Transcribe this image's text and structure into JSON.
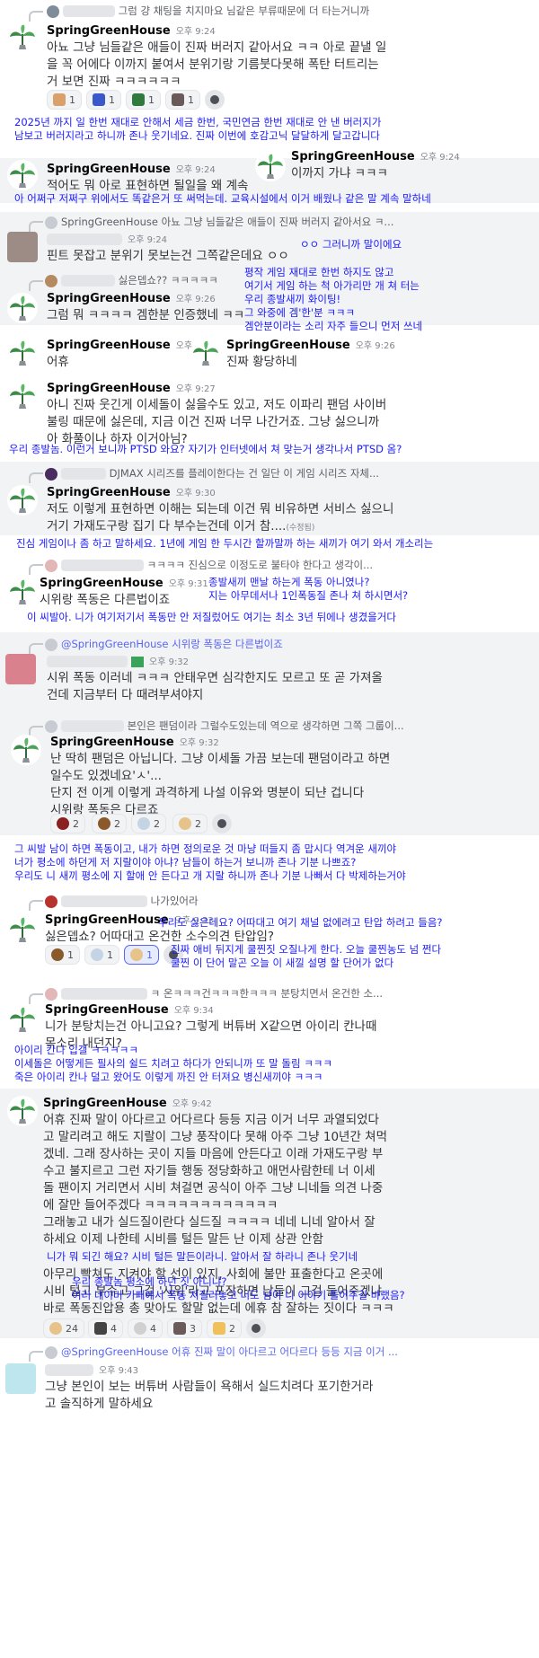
{
  "colors": {
    "annotation": "#1a1aff",
    "username": "#060607",
    "timestamp": "#80848e",
    "highlight_band": "#f2f3f5",
    "mention": "#5865f2"
  },
  "m1": {
    "reply": "그럼 걍 채팅을 치지마요 님같은 부류때문에 더 타는거니까",
    "name": "SpringGreenHouse",
    "time": "오후 9:24",
    "text": [
      "아뇨 그냥 님들같은 애들이 진짜 버러지 같아서요 ㅋㅋ 아로 끝낼 일",
      "을 꼭 어에다 이까지 붙여서 분위기랑 기름붓다못해 폭탄 터트리는",
      "거 보면 진짜 ㅋㅋㅋㅋㅋㅋ"
    ],
    "reactions": [
      "1",
      "1",
      "1",
      "1"
    ],
    "reaction_icons": [
      "emoji-face",
      "emoji-ho",
      "emoji-gam",
      "emoji-pixel"
    ]
  },
  "a1": [
    "2025년 까지 일 한번 재대로 안해서 세금 한번, 국민연금 한번 재대로 안 낸 버러지가",
    "남보고 버러지라고 하니까 존나 웃기네요. 진짜 이번에 호감고닉 달달하게 달고갑니다"
  ],
  "m2": {
    "name": "SpringGreenHouse",
    "time": "오후 9:24",
    "text": "적어도 뭐 아로 표현하면 될일을 왜 계속",
    "right_name": "SpringGreenHouse",
    "right_time": "오후 9:24",
    "right_text": "이까지 가냐 ㅋㅋㅋ"
  },
  "a2": "아 어쩌구 저쩌구 위에서도 똑같은거 또 써먹는데. 교육시설에서 이거 배웠나 같은 말 계속 말하네",
  "m3": {
    "reply_name": "SpringGreenHouse",
    "reply": "아뇨 그냥 님들같은 애들이 진짜 버러지 같아서요 ㅋ...",
    "time": "오후 9:24",
    "text": "핀트 못잡고 분위기 못보는건 그쪽같은데요 ㅇㅇ"
  },
  "a3": "ㅇㅇ 그러니까 말이에요",
  "a4": [
    "평작 게임 재대로 한번 하지도 않고",
    "여기서 게임 하는 척 아가리만 개 쳐 터는",
    "우리 종발새끼 화이팅!",
    "그 와중에 겜'한'분 ㅋㅋㅋ",
    "겜안분이라는 소리 자주 들으니 먼저 쓰네"
  ],
  "m4": {
    "reply": "싫은뎁쇼?? ㅋㅋㅋㅋㅋ",
    "name": "SpringGreenHouse",
    "time": "오후 9:26",
    "text": "그럼 뭐 ㅋㅋㅋㅋ 겜한분 인증했네 ㅋㅋ"
  },
  "m5": {
    "name": "SpringGreenHouse",
    "time": "오후 9:26",
    "text": "어휴",
    "right_name": "SpringGreenHouse",
    "right_time": "오후 9:26",
    "right_text": "진짜 황당하네"
  },
  "m6": {
    "name": "SpringGreenHouse",
    "time": "오후 9:27",
    "text": [
      "아니 진짜 웃긴게 이세돌이 싫을수도 있고, 저도 이파리 팬덤 사이버",
      "불링 때문에 싫은데, 지금 이건 진짜 너무 나간거죠. 그냥 싫으니까",
      "아 화풀이나 하자 이거아님?"
    ]
  },
  "a5": "우리 종발놈. 이런거 보니까 PTSD 와요? 자기가 인터넷에서 쳐 맞는거 생각나서 PTSD 옴?",
  "m7": {
    "reply": "DJMAX 시리즈를 플레이한다는 건 일단 이 게임 시리즈 자체...",
    "name": "SpringGreenHouse",
    "time": "오후 9:30",
    "text": [
      "저도 이렇게 표현하면 이해는 되는데 이건 뭐 비유하면 서비스 싫으니",
      "거기 가재도구랑 집기 다 부수는건데 이거 참...."
    ],
    "edited": "(수정됨)"
  },
  "a6": "진심 게임이나 좀 하고 말하세요. 1년에 게임 한 두시간 할까말까 하는 새끼가 여기 와서 개소리는",
  "m8": {
    "reply": "ㅋㅋㅋㅋ 진심으로 이정도로 불타야 한다고 생각이...",
    "name": "SpringGreenHouse",
    "time": "오후 9:31",
    "text": "시위랑 폭동은 다른법이죠"
  },
  "a7": [
    "종발새끼 맨날 하는게 폭동 아니였나?",
    "지는 아무데서나 1인폭동질 존나 쳐 하시면서?"
  ],
  "a8": "이 씨발아. 니가 여기저기서 폭동만 안 저질렀어도 여기는 최소 3년 뒤에나 생겼을거다",
  "m9": {
    "reply": "@SpringGreenHouse 시위랑 폭동은 다른법이죠",
    "time": "오후 9:32",
    "text": [
      "시위 폭동 이러네 ㅋㅋㅋ 안태우면 심각한지도 모르고 또 곧 가져올",
      "건데 지금부터 다 때려부셔야지"
    ]
  },
  "m10": {
    "reply": "본인은 팬덤이라 그럴수도있는데 역으로 생각하면 그쪽 그룹이...",
    "name": "SpringGreenHouse",
    "time": "오후 9:32",
    "text": [
      "난 딱히 팬덤은 아닙니다. 그냥 이세돌 가끔 보는데 팬덤이라고 하면",
      "일수도 있겠네요'ㅅ'...",
      "단지 전 이게 이렇게 과격하게 나설 이유와 명분이 되냔 겁니다",
      "시위랑 폭동은 다르죠"
    ],
    "reactions": [
      "2",
      "2",
      "2",
      "2"
    ],
    "reaction_icons": [
      "emoji-red",
      "emoji-bear",
      "emoji-cloud",
      "emoji-bread"
    ]
  },
  "a9": [
    "그 씨발 남이 하면 폭동이고, 내가 하면 정의로운 것 마냥 떠들지 좀 맙시다 역겨운 새끼야",
    "너가 평소에 하던게 저 지랄이야 아냐? 남들이 하는거 보니까 존나 기분 나쁘죠?",
    "우리도 니 새끼 평소에 지 할애 안 든다고 개 지랄 하니까 존나 기분 나빠서 다 박제하는거야"
  ],
  "m11": {
    "reply": "나가있어라",
    "name": "SpringGreenHouse",
    "time": "오후 9:33",
    "text1": "싫은뎁쇼?",
    "text2": "싫은뎁쇼? 어따대고 온건한 소수의견 탄압임?",
    "reactions": [
      "1",
      "1",
      "1"
    ],
    "reaction_icons": [
      "emoji-bear",
      "emoji-cloud",
      "emoji-bread"
    ]
  },
  "a10": "우리도 싫은데요? 어따대고 여기 채널 없에려고 탄압 하려고 들음?",
  "a11": [
    "진짜 애비 뒤지게 쿨찐짓 오질나게 한다. 오늘 쿨찐농도 넘 쩐다",
    "쿨찐 이 단어 말곤 오늘 이 새낄 설명 할 단어가 없다"
  ],
  "m12": {
    "reply": "ㅋ 온ㅋㅋㅋ건ㅋㅋㅋ한ㅋㅋㅋ 분탕치면서 온건한 소...",
    "name": "SpringGreenHouse",
    "time": "오후 9:34",
    "text": [
      "니가 분탕치는건 아니고요? 그렇게 버튜버 X같으면 아이리 칸나때",
      "목소리 내던지?"
    ]
  },
  "a12": [
    "아이리 칸나 입갤 ㅋㅋㅋㅋㅋ",
    "이세돌은 어떻게든 필사의 쉴드 치려고 하다가 안되니까 또 말 돌림 ㅋㅋㅋ",
    "죽은 아이리 칸나 덜고 왔어도 이렇게 까진 안 터져요 병신새끼야 ㅋㅋㅋ"
  ],
  "m13": {
    "name": "SpringGreenHouse",
    "time": "오후 9:42",
    "text": [
      "어휴 진짜 말이 아다르고 어다르다 등등 지금 이거 너무 과열되었다",
      "고 말리려고 해도 지랄이 그냥 풍작이다 못해 아주 그냥 10년간 쳐먹",
      "겠네. 그래 장사하는 곳이 지들 마음에 안든다고 이래 가재도구랑 부",
      "수고 불지르고 그런 자기들 행동 정당화하고 애먼사람한테 너 이세",
      "돌 팬이지 거리면서 시비 쳐걸면 공식이 아주 그냥 니네들 의견 나중",
      "에 잘만 들어주겠다 ㅋㅋㅋㅋㅋㅋㅋㅋㅋㅋㅋㅋ",
      "그래놓고 내가 실드질이란다 실드질 ㅋㅋㅋㅋ 네네 니네 알아서 잘",
      "하세요 이제 나한테 시비를 털든 말든 난 이제 상관 안함"
    ],
    "text2": [
      "아무리 빡쳐도 지켜야 할 선이 있지, 사회에 불만 표출한다고 온곳에",
      "시비 털고 부수고 그걸 '시위'라고 포장하면 남들이 그걸 들어주겠냐",
      "바로 폭동진압용 총 맞아도 할말 없는데 에휴 참 잘하는 짓이다 ㅋㅋㅋ",
      "ㅋ"
    ],
    "reactions": [
      "24",
      "4",
      "4",
      "3",
      "2"
    ],
    "reaction_icons": [
      "emoji-bread",
      "emoji-cat",
      "emoji-skull",
      "emoji-pixel",
      "emoji-hand"
    ]
  },
  "a13": "니가 뭐 되긴 해요? 시비 털든 말든이라니. 알아서 잘 하라니 존나 웃기네",
  "a14": [
    "우리 종발놈 평소에 하던 짓 아니냐?",
    "여러 네이버 카페에서 폭동 저질러놓고 너도 남이 니 이야기 들어주길 바랬음?"
  ],
  "m14": {
    "reply": "@SpringGreenHouse 어휴 진짜 말이 아다르고 어다르다 등등 지금 이거 ...",
    "time": "오후 9:43",
    "text": [
      "그냥 본인이 보는 버튜버 사람들이 욕해서 실드치려다 포기한거라",
      "고 솔직하게 말하세요"
    ]
  }
}
